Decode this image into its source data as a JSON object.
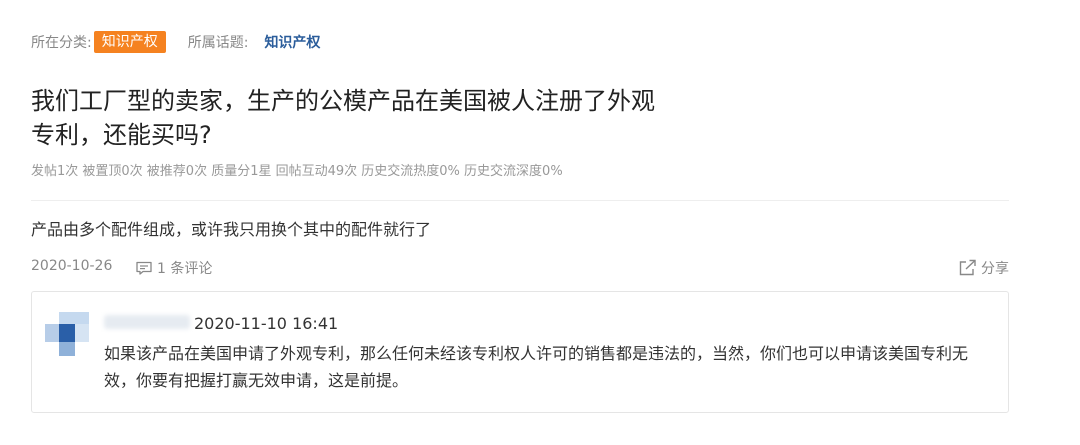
{
  "meta": {
    "category_label": "所在分类:",
    "category_value": "知识产权",
    "topic_label": "所属话题:",
    "topic_value": "知识产权"
  },
  "post": {
    "title": "我们工厂型的卖家，生产的公模产品在美国被人注册了外观专利，还能买吗?",
    "stats": "发帖1次 被置顶0次 被推荐0次 质量分1星 回帖互动49次 历史交流热度0% 历史交流深度0%",
    "body": "产品由多个配件组成，或许我只用换个其中的配件就行了",
    "date": "2020-10-26",
    "comment_count": "1 条评论",
    "share_label": "分享"
  },
  "comment": {
    "time": "2020-11-10 16:41",
    "text": "如果该产品在美国申请了外观专利，那么任何未经该专利权人许可的销售都是违法的，当然，你们也可以申请该美国专利无效，你要有把握打赢无效申请，这是前提。"
  },
  "colors": {
    "accent_orange": "#f58220",
    "topic_blue": "#2b5d9b",
    "muted_text": "#888888"
  },
  "icons": {
    "comment": "comment-icon",
    "share": "share-icon"
  }
}
